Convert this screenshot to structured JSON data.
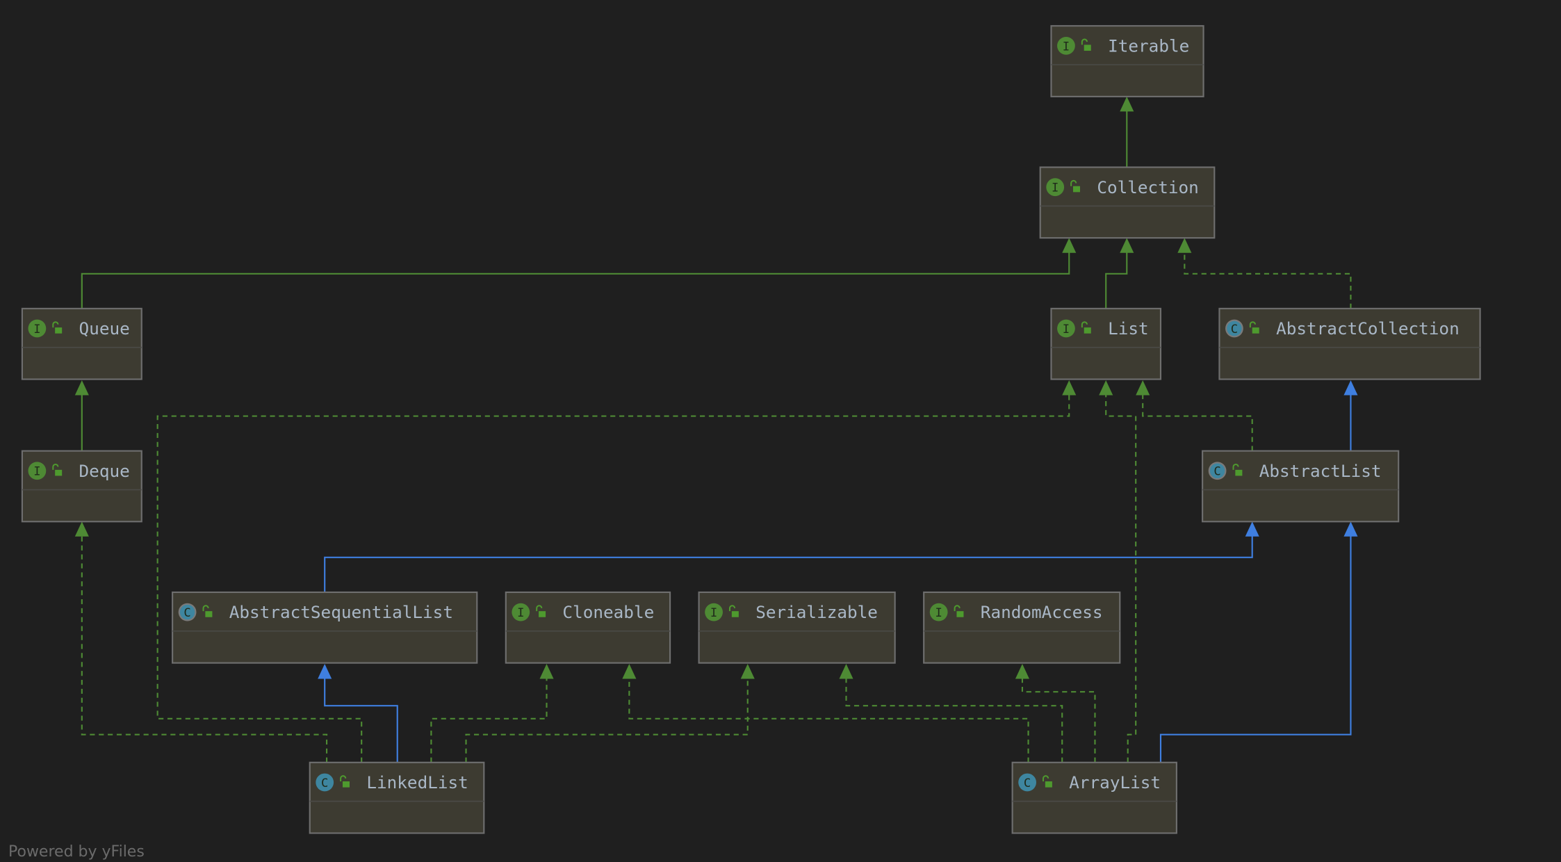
{
  "colors": {
    "background": "#1f1f1f",
    "node_fill": "#3d3b31",
    "node_border": "#6e6e6e",
    "interface_badge": "#4e8a34",
    "class_badge": "#3e86a0",
    "lock_icon": "#4e9a2e",
    "implements_edge": "#4e8a34",
    "extends_class_edge": "#3f7fe0",
    "extends_interface_edge": "#4e8a34"
  },
  "nodes": [
    {
      "id": "Iterable",
      "label": "Iterable",
      "kind": "interface",
      "badge": "I"
    },
    {
      "id": "Collection",
      "label": "Collection",
      "kind": "interface",
      "badge": "I"
    },
    {
      "id": "Queue",
      "label": "Queue",
      "kind": "interface",
      "badge": "I"
    },
    {
      "id": "List",
      "label": "List",
      "kind": "interface",
      "badge": "I"
    },
    {
      "id": "AbstractCollection",
      "label": "AbstractCollection",
      "kind": "abstract-class",
      "badge": "C"
    },
    {
      "id": "Deque",
      "label": "Deque",
      "kind": "interface",
      "badge": "I"
    },
    {
      "id": "AbstractList",
      "label": "AbstractList",
      "kind": "abstract-class",
      "badge": "C"
    },
    {
      "id": "AbstractSequentialList",
      "label": "AbstractSequentialList",
      "kind": "abstract-class",
      "badge": "C"
    },
    {
      "id": "Cloneable",
      "label": "Cloneable",
      "kind": "interface",
      "badge": "I"
    },
    {
      "id": "Serializable",
      "label": "Serializable",
      "kind": "interface",
      "badge": "I"
    },
    {
      "id": "RandomAccess",
      "label": "RandomAccess",
      "kind": "interface",
      "badge": "I"
    },
    {
      "id": "LinkedList",
      "label": "LinkedList",
      "kind": "class",
      "badge": "C"
    },
    {
      "id": "ArrayList",
      "label": "ArrayList",
      "kind": "class",
      "badge": "C"
    }
  ],
  "edges": [
    {
      "from": "Collection",
      "to": "Iterable",
      "type": "extends-interface"
    },
    {
      "from": "Queue",
      "to": "Collection",
      "type": "extends-interface"
    },
    {
      "from": "List",
      "to": "Collection",
      "type": "extends-interface"
    },
    {
      "from": "AbstractCollection",
      "to": "Collection",
      "type": "implements"
    },
    {
      "from": "Deque",
      "to": "Queue",
      "type": "extends-interface"
    },
    {
      "from": "AbstractList",
      "to": "AbstractCollection",
      "type": "extends-class"
    },
    {
      "from": "AbstractList",
      "to": "List",
      "type": "implements"
    },
    {
      "from": "LinkedList",
      "to": "List",
      "type": "implements"
    },
    {
      "from": "ArrayList",
      "to": "List",
      "type": "implements"
    },
    {
      "from": "AbstractSequentialList",
      "to": "AbstractList",
      "type": "extends-class"
    },
    {
      "from": "ArrayList",
      "to": "AbstractList",
      "type": "extends-class"
    },
    {
      "from": "LinkedList",
      "to": "AbstractSequentialList",
      "type": "extends-class"
    },
    {
      "from": "LinkedList",
      "to": "Deque",
      "type": "implements"
    },
    {
      "from": "LinkedList",
      "to": "Cloneable",
      "type": "implements"
    },
    {
      "from": "LinkedList",
      "to": "Serializable",
      "type": "implements"
    },
    {
      "from": "ArrayList",
      "to": "Cloneable",
      "type": "implements"
    },
    {
      "from": "ArrayList",
      "to": "Serializable",
      "type": "implements"
    },
    {
      "from": "ArrayList",
      "to": "RandomAccess",
      "type": "implements"
    }
  ],
  "footer": "Powered by yFiles"
}
